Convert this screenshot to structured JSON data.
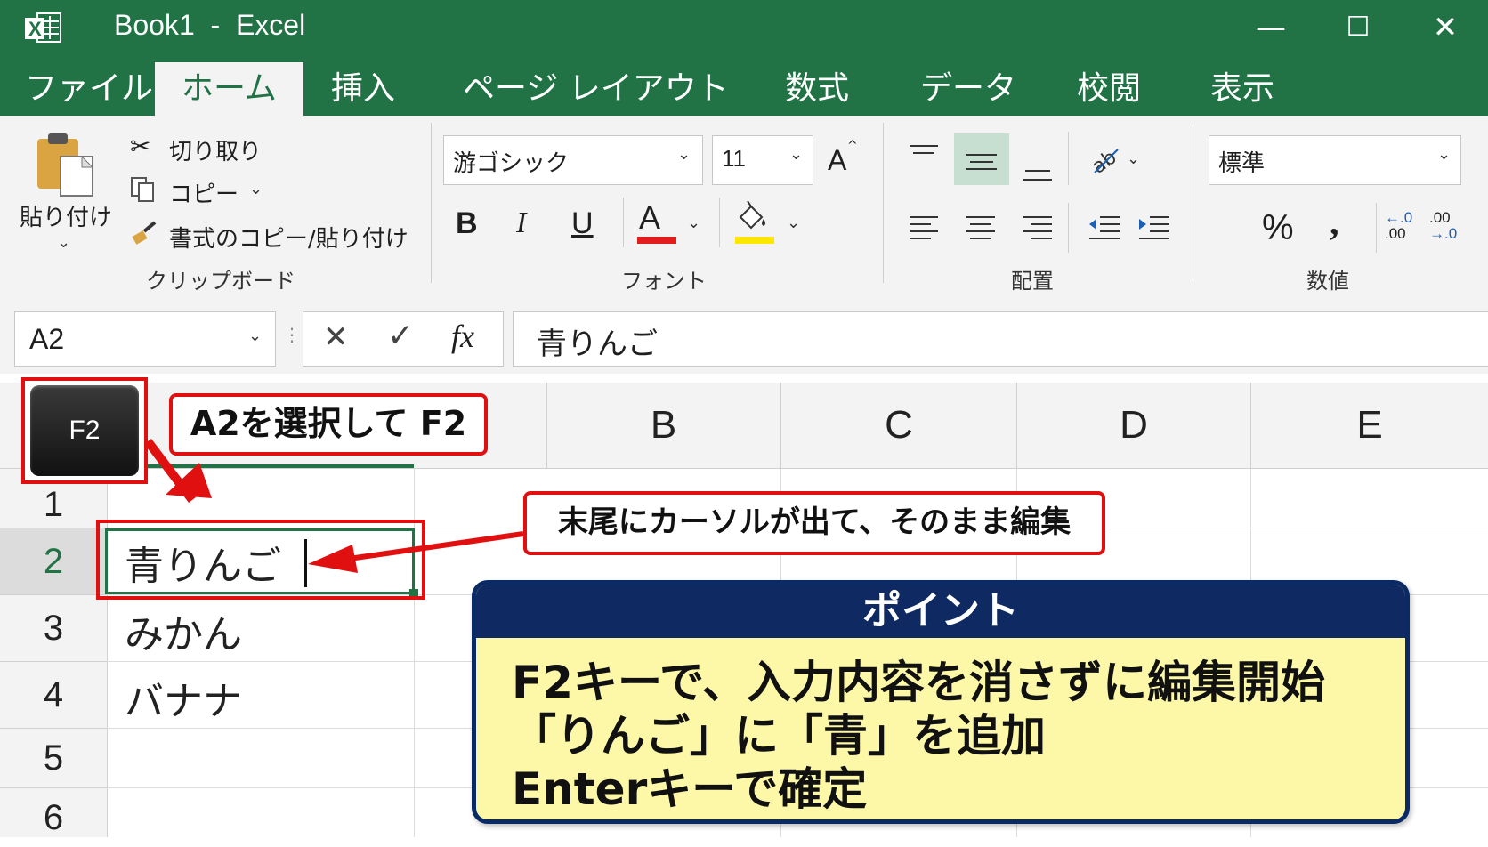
{
  "window": {
    "title": "Book1  -  Excel",
    "app_icon_letter": "X"
  },
  "window_controls": {
    "minimize": "—",
    "maximize": "☐",
    "close": "✕"
  },
  "tabs": [
    "ファイル",
    "ホーム",
    "挿入",
    "ページ レイアウト",
    "数式",
    "データ",
    "校閲",
    "表示"
  ],
  "active_tab": "ホーム",
  "ribbon": {
    "clipboard": {
      "paste": "貼り付け",
      "cut": "切り取り",
      "copy": "コピー",
      "format_painter": "書式のコピー/貼り付け",
      "label": "クリップボード"
    },
    "font": {
      "font_name": "游ゴシック",
      "font_size": "11",
      "bold": "B",
      "italic": "I",
      "underline": "U",
      "font_color_letter": "A",
      "grow_font": "A",
      "label": "フォント",
      "font_color": "#e31c1c",
      "fill_color": "#ffe600"
    },
    "alignment": {
      "label": "配置"
    },
    "number": {
      "format": "標準",
      "percent": "%",
      "comma": ",",
      "inc_decimal_top": "←.0",
      "inc_decimal_bottom": ".00",
      "dec_decimal_top": ".00",
      "dec_decimal_bottom": "→.0",
      "label": "数値"
    }
  },
  "formula_bar": {
    "name_box": "A2",
    "cancel": "✕",
    "enter": "✓",
    "fx": "fx",
    "content": "青りんご"
  },
  "sheet": {
    "columns": [
      "B",
      "C",
      "D",
      "E"
    ],
    "rows": [
      "1",
      "2",
      "3",
      "4",
      "5",
      "6"
    ],
    "cells": {
      "A2": "青りんご",
      "A3": "みかん",
      "A4": "バナナ"
    },
    "selected_cell": "A2"
  },
  "annotations": {
    "key": "F2",
    "step_label": "A2を選択して F2",
    "cursor_note": "末尾にカーソルが出て、そのまま編集",
    "point_title": "ポイント",
    "point_lines": [
      "F2キーで、入力内容を消さずに編集開始",
      "「りんご」に「青」を追加",
      "Enterキーで確定"
    ]
  },
  "colors": {
    "excel_green": "#217346",
    "callout_red": "#e01010",
    "point_navy": "#0f2a63",
    "point_yellow": "#fcf8a8"
  }
}
